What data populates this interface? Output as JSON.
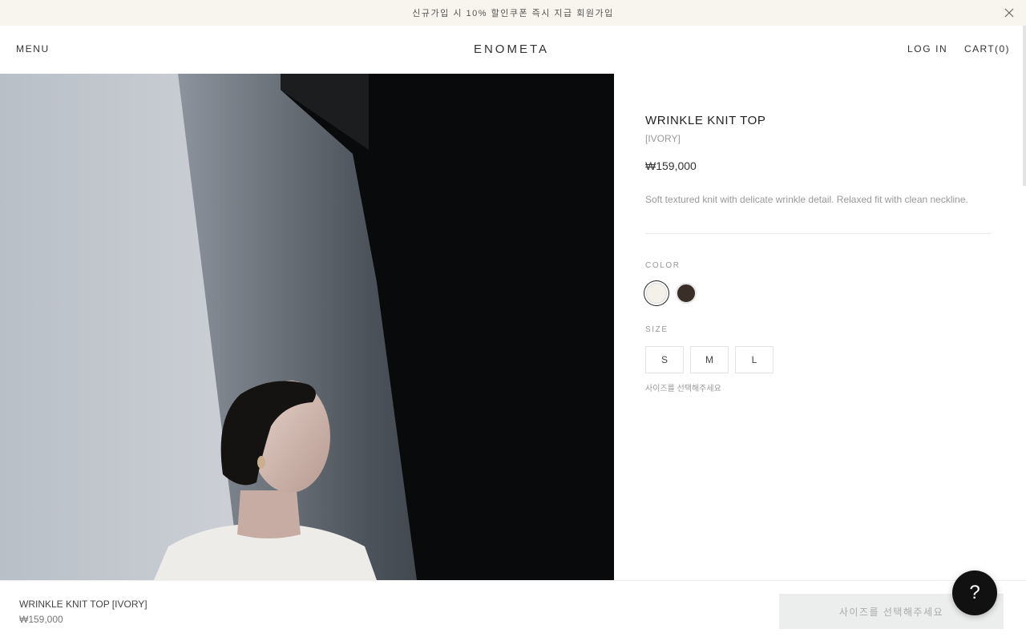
{
  "announcement": {
    "text": "신규가입 시 10% 할인쿠폰 즉시 지급  회원가입",
    "close_icon": "close-icon"
  },
  "header": {
    "menu_label": "MENU",
    "logo": "ENOMETA",
    "login_label": "LOG IN",
    "cart_label": "CART(0)"
  },
  "product": {
    "title": "WRINKLE KNIT TOP",
    "variant": "[IVORY]",
    "price": "₩159,000",
    "description": "Soft textured knit with delicate wrinkle detail. Relaxed fit with clean neckline.",
    "color_label": "COLOR",
    "colors": [
      {
        "name": "ivory",
        "hex": "#f3f1ea",
        "selected": true
      },
      {
        "name": "brown",
        "hex": "#3a2e29",
        "selected": false
      }
    ],
    "size_label": "SIZE",
    "sizes": [
      "S",
      "M",
      "L"
    ],
    "size_hint": "사이즈를 선택해주세요"
  },
  "bottom_bar": {
    "title": "WRINKLE KNIT TOP [IVORY]",
    "price": "₩159,000",
    "cta_label": "사이즈를 선택해주세요"
  },
  "help": {
    "label": "?"
  }
}
